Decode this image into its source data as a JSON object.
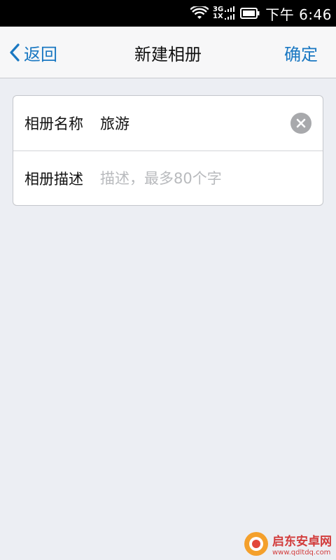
{
  "status_bar": {
    "network_top": "3G",
    "network_bottom": "1X",
    "time": "下午 6:46",
    "icons": [
      "wifi-icon",
      "signal-icon",
      "battery-icon"
    ]
  },
  "nav": {
    "back_label": "返回",
    "title": "新建相册",
    "confirm_label": "确定"
  },
  "form": {
    "name_label": "相册名称",
    "name_value": "旅游",
    "description_label": "相册描述",
    "description_placeholder": "描述，最多80个字"
  },
  "watermark": {
    "name": "启东安卓网",
    "url": "www.qdltdq.com"
  },
  "colors": {
    "accent": "#1a78c2",
    "background": "#eceef3",
    "nav_background": "#f7f7f8"
  }
}
